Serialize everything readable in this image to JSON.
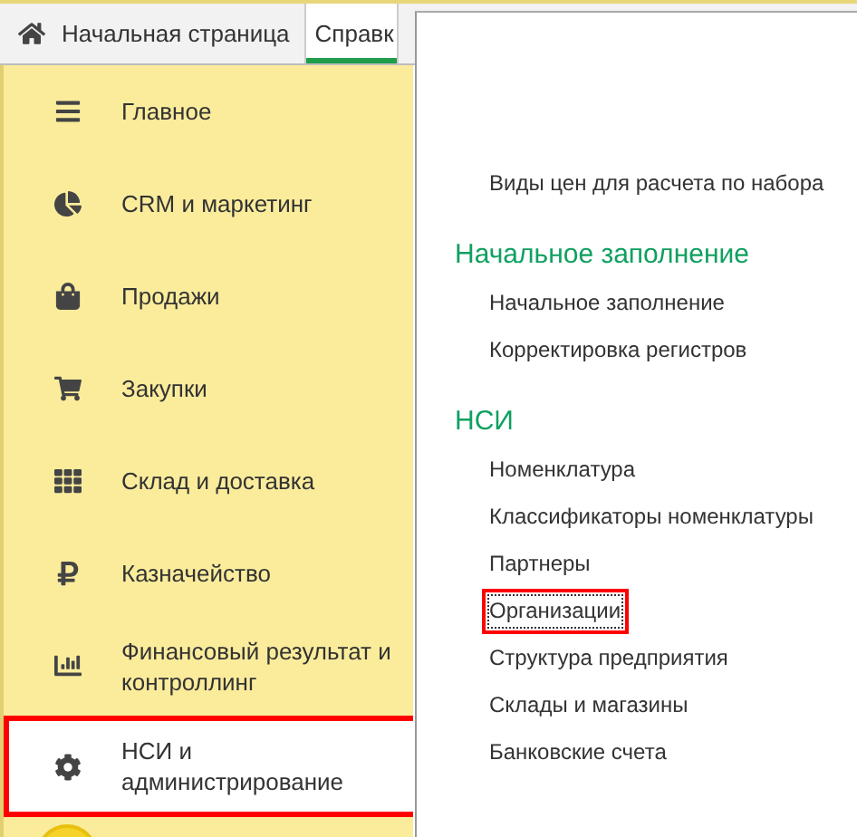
{
  "tabs": [
    {
      "label": "Начальная страница",
      "selected": false
    },
    {
      "label": "Справк",
      "selected": true
    }
  ],
  "sidebar": {
    "items": [
      {
        "label": "Главное",
        "selected": false
      },
      {
        "label": "CRM и маркетинг",
        "selected": false
      },
      {
        "label": "Продажи",
        "selected": false
      },
      {
        "label": "Закупки",
        "selected": false
      },
      {
        "label": "Склад и доставка",
        "selected": false
      },
      {
        "label": "Казначейство",
        "selected": false
      },
      {
        "label": "Финансовый результат и контроллинг",
        "selected": false
      },
      {
        "label": "НСИ и администрирование",
        "selected": true
      }
    ]
  },
  "panel": {
    "top_links": [
      {
        "label": "Виды цен для расчета по набора",
        "highlighted": false
      }
    ],
    "sections": [
      {
        "title": "Начальное заполнение",
        "links": [
          {
            "label": "Начальное заполнение",
            "highlighted": false
          },
          {
            "label": "Корректировка регистров",
            "highlighted": false
          }
        ]
      },
      {
        "title": "НСИ",
        "links": [
          {
            "label": "Номенклатура",
            "highlighted": false
          },
          {
            "label": "Классификаторы номенклатуры",
            "highlighted": false
          },
          {
            "label": "Партнеры",
            "highlighted": false
          },
          {
            "label": "Организации",
            "highlighted": true
          },
          {
            "label": "Структура предприятия",
            "highlighted": false
          },
          {
            "label": "Склады и магазины",
            "highlighted": false
          },
          {
            "label": "Банковские счета",
            "highlighted": false
          }
        ]
      }
    ]
  }
}
